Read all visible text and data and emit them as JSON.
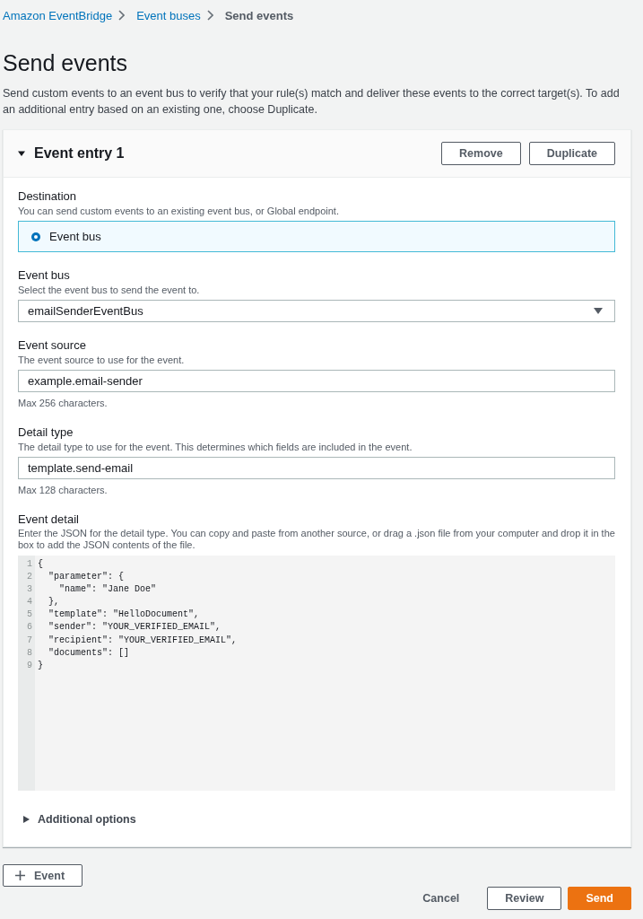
{
  "breadcrumbs": [
    {
      "label": "Amazon EventBridge",
      "kind": "link"
    },
    {
      "label": "Event buses",
      "kind": "link"
    },
    {
      "label": "Send events",
      "kind": "current"
    }
  ],
  "page": {
    "title": "Send events",
    "description": "Send custom events to an event bus to verify that your rule(s) match and deliver these events to the correct target(s). To add an additional entry based on an existing one, choose Duplicate."
  },
  "entries": [
    {
      "title": "Event entry 1",
      "expanded": true,
      "actions": [
        "Remove",
        "Duplicate"
      ],
      "destination": {
        "label": "Destination",
        "description": "You can send custom events to an existing event bus, or Global endpoint.",
        "options": [
          {
            "label": "Event bus",
            "selected": true
          }
        ]
      },
      "event_bus": {
        "label": "Event bus",
        "description": "Select the event bus to send the event to.",
        "value": "emailSenderEventBus"
      },
      "event_source": {
        "label": "Event source",
        "description": "The event source to use for the event.",
        "value": "example.email-sender",
        "constraint": "Max 256 characters."
      },
      "detail_type": {
        "label": "Detail type",
        "description": "The detail type to use for the event. This determines which fields are included in the event.",
        "value": "template.send-email",
        "constraint": "Max 128 characters."
      },
      "event_detail": {
        "label": "Event detail",
        "description": "Enter the JSON for the detail type. You can copy and paste from another source, or drag a .json file from your computer and drop it in the box to add the JSON contents of the file.",
        "lines": [
          {
            "number": "1",
            "code": "{"
          },
          {
            "number": "2",
            "code": "  \"parameter\": {"
          },
          {
            "number": "3",
            "code": "    \"name\": \"Jane Doe\""
          },
          {
            "number": "4",
            "code": "  },"
          },
          {
            "number": "5",
            "code": "  \"template\": \"HelloDocument\","
          },
          {
            "number": "6",
            "code": "  \"sender\": \"YOUR_VERIFIED_EMAIL\","
          },
          {
            "number": "7",
            "code": "  \"recipient\": \"YOUR_VERIFIED_EMAIL\","
          },
          {
            "number": "8",
            "code": "  \"documents\": []"
          },
          {
            "number": "9",
            "code": "}"
          }
        ]
      },
      "additional_options": {
        "label": "Additional options",
        "expanded": false
      }
    }
  ],
  "add_event_button": "Event",
  "footer": {
    "buttons": [
      {
        "label": "Cancel",
        "kind": "link"
      },
      {
        "label": "Review",
        "kind": "normal"
      },
      {
        "label": "Send",
        "kind": "primary"
      }
    ]
  }
}
